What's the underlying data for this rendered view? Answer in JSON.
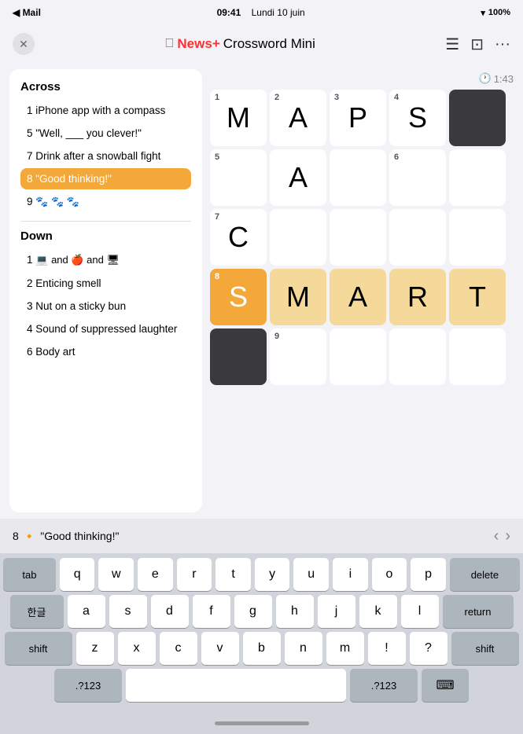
{
  "statusBar": {
    "left": "◀ Mail",
    "time": "09:41",
    "date": "Lundi 10 juin",
    "wifi": "WiFi",
    "battery": "100%"
  },
  "navBar": {
    "closeIcon": "✕",
    "titleApple": "",
    "titleNewsPlus": "News+",
    "titleCrossword": " Crossword Mini",
    "dotsIcon": "···",
    "listIcon": "≡",
    "screenIcon": "⊡",
    "moreIcon": "···"
  },
  "timer": {
    "icon": "🕐",
    "value": "1:43"
  },
  "clues": {
    "acrossTitle": "Across",
    "acrossItems": [
      {
        "number": "1",
        "text": "iPhone app with a compass",
        "active": false
      },
      {
        "number": "5",
        "text": "\"Well, ___ you clever!\"",
        "active": false
      },
      {
        "number": "7",
        "text": "Drink after a snowball fight",
        "active": false
      },
      {
        "number": "8",
        "text": "\"Good thinking!\"",
        "active": true
      },
      {
        "number": "9",
        "text": "🐾 🐾 🐾",
        "active": false
      }
    ],
    "downTitle": "Down",
    "downItems": [
      {
        "number": "1",
        "text": "💻 and 🍎 and 🖥",
        "active": false
      },
      {
        "number": "2",
        "text": "Enticing smell",
        "active": false
      },
      {
        "number": "3",
        "text": "Nut on a sticky bun",
        "active": false
      },
      {
        "number": "4",
        "text": "Sound of suppressed laughter",
        "active": false
      },
      {
        "number": "6",
        "text": "Body art",
        "active": false
      }
    ]
  },
  "grid": {
    "rows": 5,
    "cols": 5,
    "cells": [
      {
        "row": 0,
        "col": 0,
        "number": "1",
        "letter": "M",
        "type": "normal"
      },
      {
        "row": 0,
        "col": 1,
        "number": "2",
        "letter": "A",
        "type": "normal"
      },
      {
        "row": 0,
        "col": 2,
        "number": "3",
        "letter": "P",
        "type": "normal"
      },
      {
        "row": 0,
        "col": 3,
        "number": "4",
        "letter": "S",
        "type": "normal"
      },
      {
        "row": 0,
        "col": 4,
        "number": "",
        "letter": "",
        "type": "black"
      },
      {
        "row": 1,
        "col": 0,
        "number": "5",
        "letter": "",
        "type": "normal"
      },
      {
        "row": 1,
        "col": 1,
        "number": "",
        "letter": "A",
        "type": "normal"
      },
      {
        "row": 1,
        "col": 2,
        "number": "",
        "letter": "",
        "type": "normal"
      },
      {
        "row": 1,
        "col": 3,
        "number": "6",
        "letter": "",
        "type": "normal"
      },
      {
        "row": 1,
        "col": 4,
        "number": "",
        "letter": "",
        "type": "normal"
      },
      {
        "row": 2,
        "col": 0,
        "number": "7",
        "letter": "C",
        "type": "normal"
      },
      {
        "row": 2,
        "col": 1,
        "number": "",
        "letter": "",
        "type": "normal"
      },
      {
        "row": 2,
        "col": 2,
        "number": "",
        "letter": "",
        "type": "normal"
      },
      {
        "row": 2,
        "col": 3,
        "number": "",
        "letter": "",
        "type": "normal"
      },
      {
        "row": 2,
        "col": 4,
        "number": "",
        "letter": "",
        "type": "normal"
      },
      {
        "row": 3,
        "col": 0,
        "number": "8",
        "letter": "S",
        "type": "active"
      },
      {
        "row": 3,
        "col": 1,
        "number": "",
        "letter": "M",
        "type": "highlighted"
      },
      {
        "row": 3,
        "col": 2,
        "number": "",
        "letter": "A",
        "type": "highlighted"
      },
      {
        "row": 3,
        "col": 3,
        "number": "",
        "letter": "R",
        "type": "highlighted"
      },
      {
        "row": 3,
        "col": 4,
        "number": "",
        "letter": "T",
        "type": "highlighted"
      },
      {
        "row": 4,
        "col": 0,
        "number": "",
        "letter": "",
        "type": "black"
      },
      {
        "row": 4,
        "col": 1,
        "number": "9",
        "letter": "",
        "type": "normal"
      },
      {
        "row": 4,
        "col": 2,
        "number": "",
        "letter": "",
        "type": "normal"
      },
      {
        "row": 4,
        "col": 3,
        "number": "",
        "letter": "",
        "type": "normal"
      },
      {
        "row": 4,
        "col": 4,
        "number": "",
        "letter": "",
        "type": "normal"
      }
    ]
  },
  "bottomClue": {
    "number": "8",
    "icon": "🔶",
    "text": "\"Good thinking!\""
  },
  "keyboard": {
    "rows": [
      {
        "keys": [
          {
            "label": "tab",
            "type": "special"
          },
          {
            "label": "q",
            "type": "normal"
          },
          {
            "label": "w",
            "type": "normal"
          },
          {
            "label": "e",
            "type": "normal"
          },
          {
            "label": "r",
            "type": "normal"
          },
          {
            "label": "t",
            "type": "normal"
          },
          {
            "label": "y",
            "type": "normal"
          },
          {
            "label": "u",
            "type": "normal"
          },
          {
            "label": "i",
            "type": "normal"
          },
          {
            "label": "o",
            "type": "normal"
          },
          {
            "label": "p",
            "type": "normal"
          },
          {
            "label": "delete",
            "type": "delete-key"
          }
        ]
      },
      {
        "keys": [
          {
            "label": "한글",
            "type": "special"
          },
          {
            "label": "a",
            "type": "normal"
          },
          {
            "label": "s",
            "type": "normal"
          },
          {
            "label": "d",
            "type": "normal"
          },
          {
            "label": "f",
            "type": "normal"
          },
          {
            "label": "g",
            "type": "normal"
          },
          {
            "label": "h",
            "type": "normal"
          },
          {
            "label": "j",
            "type": "normal"
          },
          {
            "label": "k",
            "type": "normal"
          },
          {
            "label": "l",
            "type": "normal"
          },
          {
            "label": "return",
            "type": "return-key"
          }
        ]
      },
      {
        "keys": [
          {
            "label": "shift",
            "type": "wide-special"
          },
          {
            "label": "z",
            "type": "normal"
          },
          {
            "label": "x",
            "type": "normal"
          },
          {
            "label": "c",
            "type": "normal"
          },
          {
            "label": "v",
            "type": "normal"
          },
          {
            "label": "b",
            "type": "normal"
          },
          {
            "label": "n",
            "type": "normal"
          },
          {
            "label": "m",
            "type": "normal"
          },
          {
            "label": "!",
            "type": "normal"
          },
          {
            "label": "?",
            "type": "normal"
          },
          {
            "label": "shift",
            "type": "wide-special"
          }
        ]
      },
      {
        "keys": [
          {
            "label": ".?123",
            "type": "wide-special"
          },
          {
            "label": "",
            "type": "space-key"
          },
          {
            "label": ".?123",
            "type": "wide-special"
          },
          {
            "label": "⌨",
            "type": "keyboard-icon"
          }
        ]
      }
    ]
  }
}
